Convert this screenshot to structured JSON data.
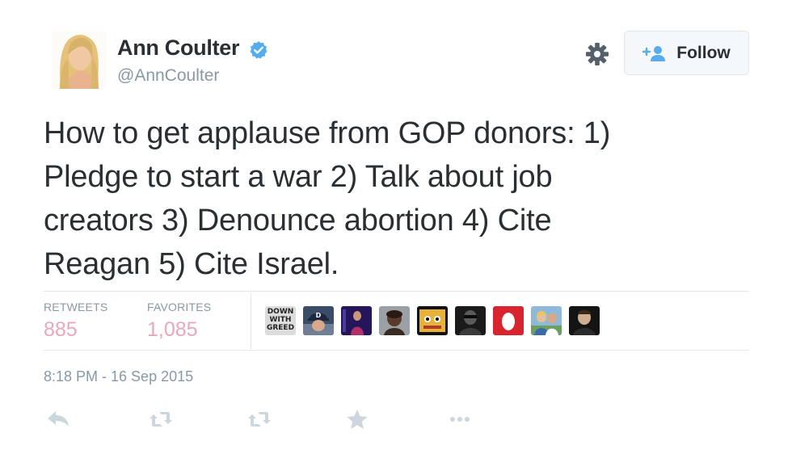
{
  "user": {
    "name": "Ann Coulter",
    "handle": "@AnnCoulter"
  },
  "follow_button": {
    "label": "Follow"
  },
  "tweet": {
    "lines": [
      "How to get applause from GOP donors: 1)",
      "Pledge to start a war 2) Talk about job",
      "creators 3) Denounce abortion 4) Cite",
      "Reagan 5) Cite Israel."
    ]
  },
  "stats": {
    "retweets": {
      "label": "RETWEETS",
      "value": "885"
    },
    "favorites": {
      "label": "FAVORITES",
      "value": "1,085"
    }
  },
  "favoriter_avatars": [
    {
      "kind": "text",
      "text": "DOWN WITH GREED"
    },
    {
      "kind": "image",
      "name": "favoriter-avatar-cap"
    },
    {
      "kind": "image",
      "name": "favoriter-avatar-stage"
    },
    {
      "kind": "image",
      "name": "favoriter-avatar-portrait"
    },
    {
      "kind": "image",
      "name": "favoriter-avatar-cartoon"
    },
    {
      "kind": "image",
      "name": "favoriter-avatar-dark"
    },
    {
      "kind": "image",
      "name": "favoriter-avatar-egg"
    },
    {
      "kind": "image",
      "name": "favoriter-avatar-couple"
    },
    {
      "kind": "image",
      "name": "favoriter-avatar-man"
    }
  ],
  "timestamp": "8:18 PM - 16 Sep 2015",
  "actions": [
    "reply-icon",
    "retweet-icon",
    "retweet-icon",
    "favorite-star-icon",
    "more-dots-icon"
  ],
  "colors": {
    "text": "#292f33",
    "muted": "#8899a6",
    "stat_value": "#e8a8b8",
    "verified": "#55acee",
    "border": "#e1e8ed",
    "icon": "#ccd6dd"
  }
}
